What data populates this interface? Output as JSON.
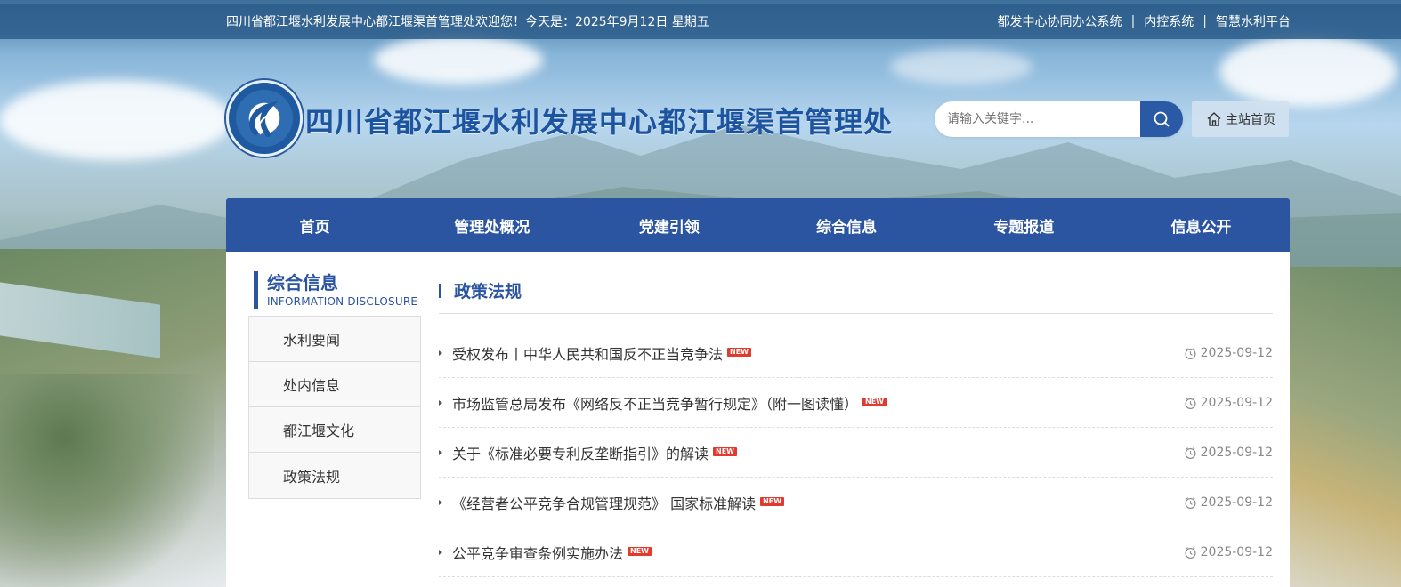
{
  "topbar": {
    "welcome": "四川省都江堰水利发展中心都江堰渠首管理处欢迎您！今天是：2025年9月12日 星期五",
    "links": [
      {
        "label": "都发中心协同办公系统"
      },
      {
        "label": "内控系统"
      },
      {
        "label": "智慧水利平台"
      }
    ],
    "separator": "|"
  },
  "header": {
    "site_title": "四川省都江堰水利发展中心都江堰渠首管理处",
    "search_placeholder": "请输入关键字...",
    "home_label": "主站首页"
  },
  "nav": {
    "items": [
      {
        "label": "首页"
      },
      {
        "label": "管理处概况"
      },
      {
        "label": "党建引领"
      },
      {
        "label": "综合信息"
      },
      {
        "label": "专题报道"
      },
      {
        "label": "信息公开"
      }
    ]
  },
  "sidebar": {
    "title": "综合信息",
    "subtitle": "INFORMATION DISCLOSURE",
    "items": [
      {
        "label": "水利要闻"
      },
      {
        "label": "处内信息"
      },
      {
        "label": "都江堰文化"
      },
      {
        "label": "政策法规"
      }
    ]
  },
  "main": {
    "title": "政策法规",
    "badge": "NEW",
    "news": [
      {
        "title": "受权发布丨中华人民共和国反不正当竞争法",
        "date": "2025-09-12"
      },
      {
        "title": "市场监管总局发布《网络反不正当竞争暂行规定》（附一图读懂）",
        "date": "2025-09-12"
      },
      {
        "title": "关于《标准必要专利反垄断指引》的解读",
        "date": "2025-09-12"
      },
      {
        "title": "《经营者公平竞争合规管理规范》 国家标准解读",
        "date": "2025-09-12"
      },
      {
        "title": "公平竞争审查条例实施办法",
        "date": "2025-09-12"
      }
    ]
  },
  "colors": {
    "primary": "#2b55a1",
    "topbar": "#2c5c8a",
    "new_badge": "#e23b2e"
  },
  "icons": {
    "search": "search-icon",
    "home": "home-icon",
    "clock": "clock-icon"
  }
}
